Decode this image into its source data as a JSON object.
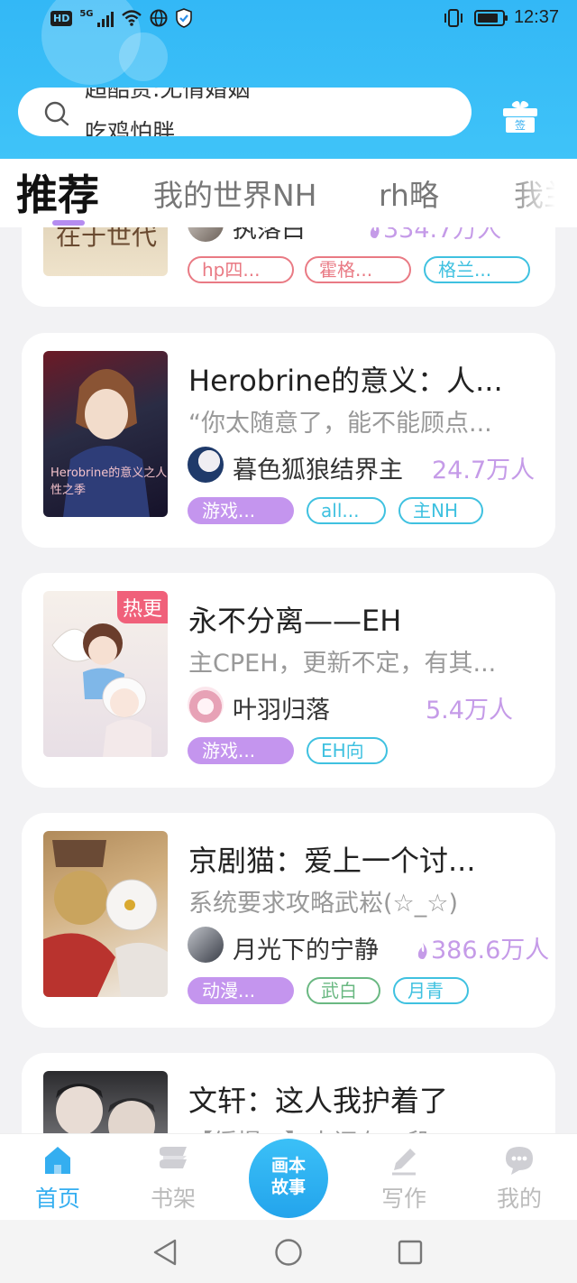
{
  "status_bar": {
    "hd": "HD",
    "network": "5G",
    "time": "12:37"
  },
  "search": {
    "hint_line_1": "超酷赏:无情婚姻",
    "hint_line_2": "吃鸡怕胖"
  },
  "gift_icon_label": "签",
  "tabs": [
    {
      "label": "推荐",
      "active": true
    },
    {
      "label": "我的世界NH",
      "active": false
    },
    {
      "label": "rh略",
      "active": false
    },
    {
      "label": "我兰",
      "active": false
    }
  ],
  "cards": [
    {
      "title": "",
      "cover_text": "在于世代",
      "author": "执落白",
      "heat": "334.7万人",
      "has_flame": true,
      "tags": [
        {
          "label": "hp四...",
          "style": "red"
        },
        {
          "label": "霍格...",
          "style": "red"
        },
        {
          "label": "格兰...",
          "style": "teal"
        }
      ]
    },
    {
      "title": "Herobrine的意义：人...",
      "desc": "“你太随意了，能不能顾点...",
      "cover_text": "Herobrine的意义之人性之季",
      "author": "暮色狐狼结界主",
      "heat": "24.7万人",
      "has_flame": false,
      "tags": [
        {
          "label": "游戏...",
          "style": "purple"
        },
        {
          "label": "all...",
          "style": "teal"
        },
        {
          "label": "主NH",
          "style": "teal"
        }
      ]
    },
    {
      "title": "永不分离——EH",
      "desc": "主CPEH，更新不定，有其...",
      "hot_badge": "热更",
      "author": "叶羽归落",
      "heat": "5.4万人",
      "has_flame": false,
      "tags": [
        {
          "label": "游戏...",
          "style": "purple"
        },
        {
          "label": "EH向",
          "style": "teal"
        }
      ]
    },
    {
      "title": "京剧猫：爱上一个讨...",
      "desc": "系统要求攻略武崧(☆_☆)",
      "author": "月光下的宁静",
      "heat": "386.6万人",
      "has_flame": true,
      "tags": [
        {
          "label": "动漫...",
          "style": "purple"
        },
        {
          "label": "武白",
          "style": "green"
        },
        {
          "label": "月青",
          "style": "teal"
        }
      ]
    },
    {
      "title": "文轩：这人我护着了",
      "desc": "【缓慢...】中间有一段..."
    }
  ],
  "bottom_nav": [
    {
      "label": "首页",
      "icon": "home-icon",
      "active": true
    },
    {
      "label": "书架",
      "icon": "bookshelf-icon",
      "active": false
    },
    {
      "label": "写作",
      "icon": "pen-icon",
      "active": false
    },
    {
      "label": "我的",
      "icon": "chat-bubble-icon",
      "active": false
    }
  ],
  "center_button": {
    "line1": "画本",
    "line2": "故事"
  },
  "colors": {
    "header_blue": "#3fc3f8",
    "accent_purple": "#c495ee",
    "tag_teal": "#3fc1e0",
    "tag_red": "#e97a84",
    "tag_green": "#6ab882",
    "nav_active": "#34aef0"
  }
}
